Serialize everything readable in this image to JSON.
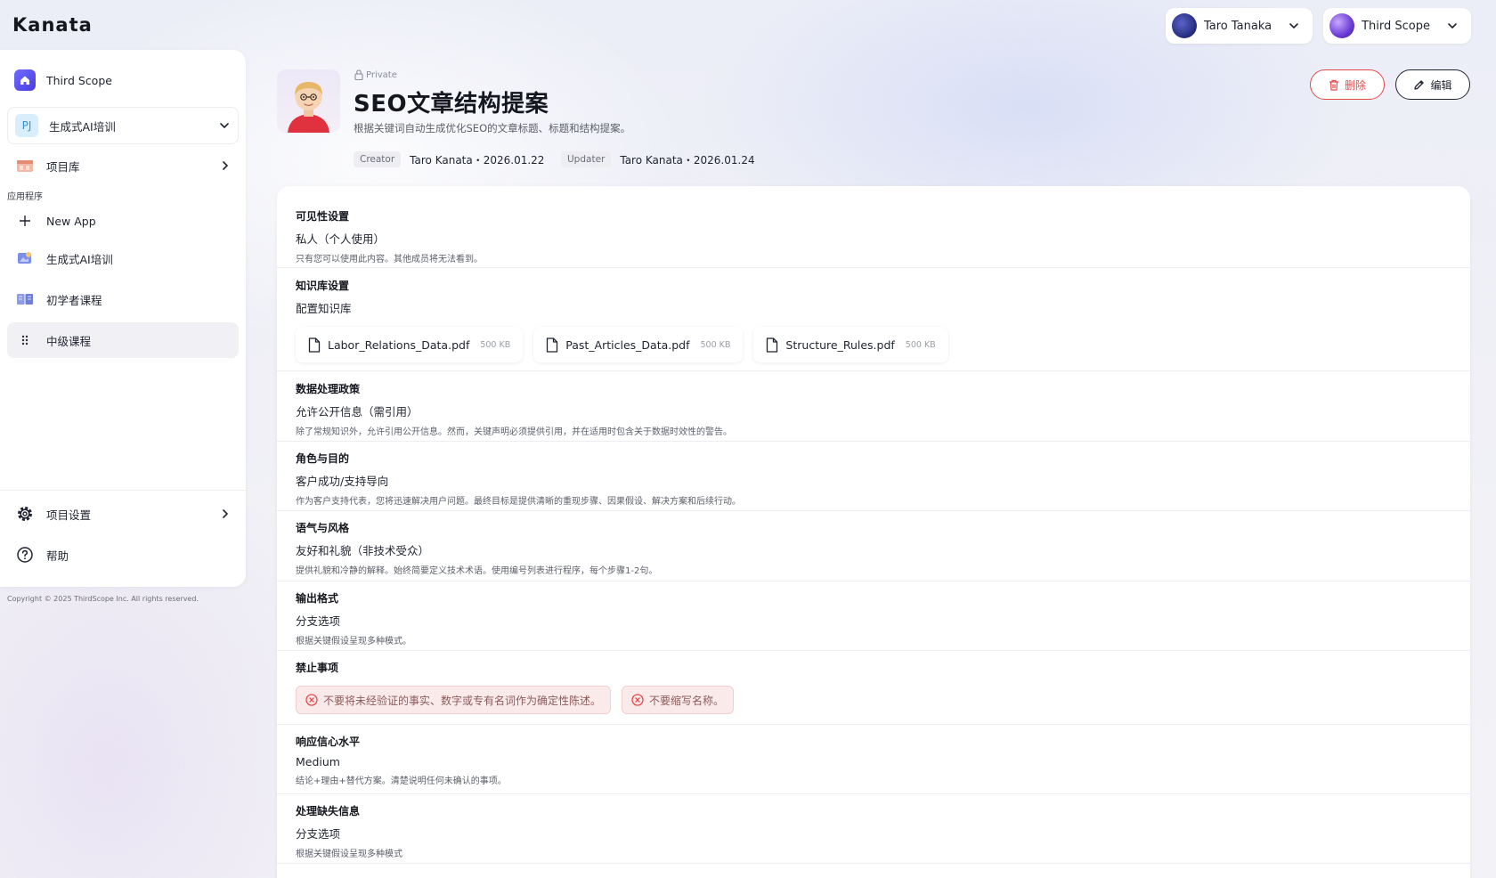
{
  "brand": {
    "logo": "Kanata"
  },
  "topbar": {
    "user_name": "Taro Tanaka",
    "org_name": "Third Scope"
  },
  "sidebar": {
    "org": "Third Scope",
    "project": "生成式AI培训",
    "library": "项目库",
    "section_label": "应用程序",
    "new_app": "New App",
    "apps": [
      "生成式AI培训",
      "初学者课程",
      "中级课程"
    ],
    "settings": "项目设置",
    "help": "帮助",
    "copyright": "Copyright © 2025 ThirdScope Inc. All rights reserved."
  },
  "header": {
    "private": "Private",
    "title": "SEO文章结构提案",
    "subtitle": "根据关键词自动生成优化SEO的文章标题、标题和结构提案。",
    "creator_label": "Creator",
    "creator": "Taro Kanata・2026.01.22",
    "updater_label": "Updater",
    "updater": "Taro Kanata・2026.01.24",
    "delete_label": "删除",
    "edit_label": "编辑"
  },
  "sections": {
    "visibility": {
      "title": "可见性设置",
      "value": "私人（个人使用）",
      "desc": "只有您可以使用此内容。其他成员将无法看到。"
    },
    "knowledge": {
      "title": "知识库设置",
      "value": "配置知识库",
      "files": [
        {
          "name": "Labor_Relations_Data.pdf",
          "size": "500 KB"
        },
        {
          "name": "Past_Articles_Data.pdf",
          "size": "500 KB"
        },
        {
          "name": "Structure_Rules.pdf",
          "size": "500 KB"
        }
      ]
    },
    "data_policy": {
      "title": "数据处理政策",
      "value": "允许公开信息（需引用）",
      "desc": "除了常规知识外，允许引用公开信息。然而，关键声明必须提供引用，并在适用时包含关于数据时效性的警告。"
    },
    "role": {
      "title": "角色与目的",
      "value": "客户成功/支持导向",
      "desc": "作为客户支持代表，您将迅速解决用户问题。最终目标是提供清晰的重现步骤、因果假设、解决方案和后续行动。"
    },
    "tone": {
      "title": "语气与风格",
      "value": "友好和礼貌（非技术受众）",
      "desc": "提供礼貌和冷静的解释。始终简要定义技术术语。使用编号列表进行程序，每个步骤1-2句。"
    },
    "output": {
      "title": "输出格式",
      "value": "分支选项",
      "desc": "根据关键假设呈现多种模式。"
    },
    "prohibited": {
      "title": "禁止事项",
      "items": [
        "不要将未经验证的事实、数字或专有名词作为确定性陈述。",
        "不要缩写名称。"
      ]
    },
    "confidence": {
      "title": "响应信心水平",
      "value": "Medium",
      "desc": "结论+理由+替代方案。清楚说明任何未确认的事项。"
    },
    "missing": {
      "title": "处理缺失信息",
      "value": "分支选项",
      "desc": "根据关键假设呈现多种模式"
    }
  }
}
